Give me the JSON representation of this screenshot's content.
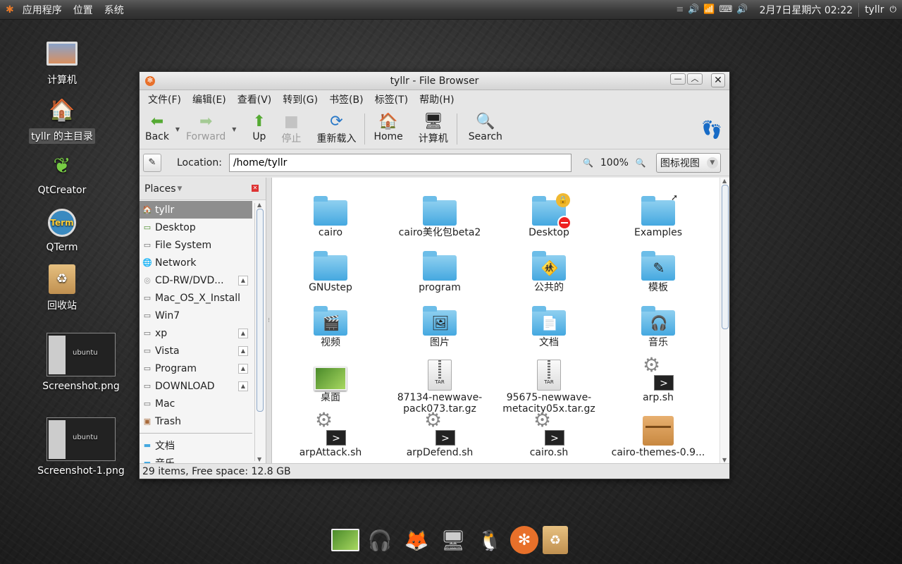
{
  "panel": {
    "menus": [
      "应用程序",
      "位置",
      "系统"
    ],
    "datetime": "2月7日星期六 02:22",
    "user": "tyllr"
  },
  "desktop": {
    "icons": [
      {
        "label": "计算机",
        "icon": "computer-icon"
      },
      {
        "label": "tyllr 的主目录",
        "icon": "home-folder-icon"
      },
      {
        "label": "QtCreator",
        "icon": "qtcreator-icon"
      },
      {
        "label": "QTerm",
        "icon": "qterm-icon"
      },
      {
        "label": "回收站",
        "icon": "trash-icon"
      },
      {
        "label": "Screenshot.png",
        "icon": "screenshot-thumbnail",
        "thumb_text": "ubuntu"
      },
      {
        "label": "Screenshot-1.png",
        "icon": "screenshot-thumbnail",
        "thumb_text": "ubuntu"
      }
    ]
  },
  "window": {
    "title": "tyllr - File Browser",
    "menu": [
      "文件(F)",
      "编辑(E)",
      "查看(V)",
      "转到(G)",
      "书签(B)",
      "标签(T)",
      "帮助(H)"
    ],
    "toolbar": {
      "back": "Back",
      "forward": "Forward",
      "up": "Up",
      "stop": "停止",
      "reload": "重新载入",
      "home": "Home",
      "computer": "计算机",
      "search": "Search"
    },
    "location": {
      "label": "Location:",
      "value": "/home/tyllr"
    },
    "zoom": "100%",
    "view": "图标视图",
    "sidebar": {
      "title": "Places",
      "items": [
        {
          "label": "tyllr",
          "icon": "home-icon"
        },
        {
          "label": "Desktop",
          "icon": "desktop-icon"
        },
        {
          "label": "File System",
          "icon": "drive-icon"
        },
        {
          "label": "Network",
          "icon": "network-icon"
        },
        {
          "label": "CD-RW/DVD...",
          "icon": "cdrom-icon",
          "eject": true
        },
        {
          "label": "Mac_OS_X_Install",
          "icon": "drive-icon"
        },
        {
          "label": "Win7",
          "icon": "drive-icon"
        },
        {
          "label": "xp",
          "icon": "drive-icon",
          "eject": true
        },
        {
          "label": "Vista",
          "icon": "drive-icon",
          "eject": true
        },
        {
          "label": "Program",
          "icon": "drive-icon",
          "eject": true
        },
        {
          "label": "DOWNLOAD",
          "icon": "drive-icon",
          "eject": true
        },
        {
          "label": "Mac",
          "icon": "drive-icon"
        },
        {
          "label": "Trash",
          "icon": "trash-icon"
        }
      ],
      "bookmarks": [
        {
          "label": "文档",
          "icon": "folder-icon"
        },
        {
          "label": "音乐",
          "icon": "folder-icon"
        }
      ]
    },
    "files": [
      {
        "name": "cairo",
        "type": "folder"
      },
      {
        "name": "cairo美化包beta2",
        "type": "folder"
      },
      {
        "name": "Desktop",
        "type": "folder-locked"
      },
      {
        "name": "Examples",
        "type": "folder-link"
      },
      {
        "name": "GNUstep",
        "type": "folder"
      },
      {
        "name": "program",
        "type": "folder"
      },
      {
        "name": "公共的",
        "type": "folder-public"
      },
      {
        "name": "模板",
        "type": "folder-templates"
      },
      {
        "name": "视频",
        "type": "folder-video"
      },
      {
        "name": "图片",
        "type": "folder-pictures"
      },
      {
        "name": "文档",
        "type": "folder-documents"
      },
      {
        "name": "音乐",
        "type": "folder-music"
      },
      {
        "name": "桌面",
        "type": "image"
      },
      {
        "name": "87134-newwave-pack073.tar.gz",
        "type": "tar"
      },
      {
        "name": "95675-newwave-metacity05x.tar.gz",
        "type": "tar"
      },
      {
        "name": "arp.sh",
        "type": "script"
      },
      {
        "name": "arpAttack.sh",
        "type": "script"
      },
      {
        "name": "arpDefend.sh",
        "type": "script"
      },
      {
        "name": "cairo.sh",
        "type": "script"
      },
      {
        "name": "cairo-themes-0.9...",
        "type": "package"
      }
    ],
    "file_labels_wrapped": {
      "13": [
        "87134-newwave-",
        "pack073.tar.gz"
      ],
      "14": [
        "95675-newwave-",
        "metacity05x.tar.gz"
      ]
    },
    "tar_label": "TAR",
    "status": "29 items, Free space: 12.8 GB"
  },
  "dock": [
    "image-viewer-icon",
    "music-player-icon",
    "firefox-icon",
    "computer-icon",
    "qq-icon",
    "ubuntu-icon",
    "trash-icon"
  ]
}
